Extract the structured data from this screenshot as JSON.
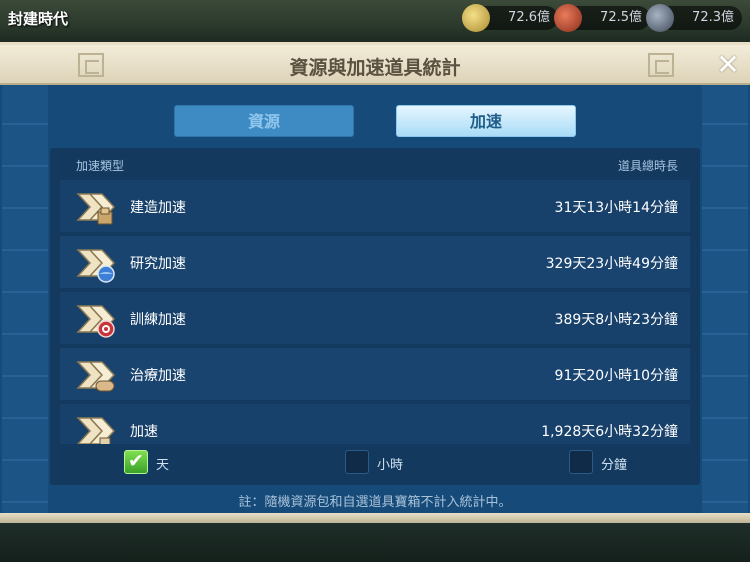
{
  "hud": {
    "title": "封建時代",
    "resources": [
      {
        "icon": "food-icon",
        "value": "72.6億"
      },
      {
        "icon": "wood-icon",
        "value": "72.5億"
      },
      {
        "icon": "stone-icon",
        "value": "72.3億"
      }
    ]
  },
  "dialog": {
    "title": "資源與加速道具統計",
    "close_label": "✕",
    "tabs": [
      {
        "label": "資源",
        "active": false
      },
      {
        "label": "加速",
        "active": true
      }
    ],
    "columns": {
      "type": "加速類型",
      "total": "道具總時長"
    },
    "rows": [
      {
        "icon": "build-speedup-icon",
        "label": "建造加速",
        "value": "31天13小時14分鐘"
      },
      {
        "icon": "research-speedup-icon",
        "label": "研究加速",
        "value": "329天23小時49分鐘"
      },
      {
        "icon": "training-speedup-icon",
        "label": "訓練加速",
        "value": "389天8小時23分鐘"
      },
      {
        "icon": "healing-speedup-icon",
        "label": "治療加速",
        "value": "91天20小時10分鐘"
      },
      {
        "icon": "universal-speedup-icon",
        "label": "加速",
        "value": "1,928天6小時32分鐘"
      }
    ],
    "options": [
      {
        "label": "天",
        "checked": true
      },
      {
        "label": "小時",
        "checked": false
      },
      {
        "label": "分鐘",
        "checked": false
      }
    ],
    "note": "註：隨機資源包和自選道具寶箱不計入統計中。"
  }
}
